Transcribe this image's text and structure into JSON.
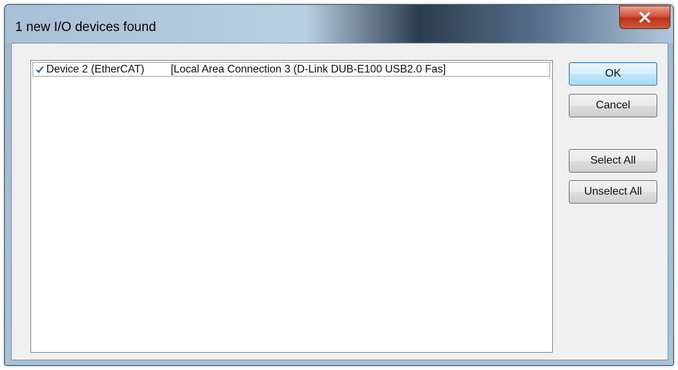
{
  "dialog": {
    "title": "1 new I/O devices found"
  },
  "device_list": {
    "items": [
      {
        "checked": true,
        "name": "Device 2 (EtherCAT)",
        "connection": "[Local Area Connection 3 (D-Link DUB-E100 USB2.0 Fas]"
      }
    ]
  },
  "buttons": {
    "ok": "OK",
    "cancel": "Cancel",
    "select_all": "Select All",
    "unselect_all": "Unselect All"
  },
  "icons": {
    "close": "close-icon",
    "check": "checkmark-icon"
  },
  "colors": {
    "close_button": "#c4472c",
    "default_button_border": "#3c7fb1",
    "checkmark": "#1f5fa8"
  }
}
